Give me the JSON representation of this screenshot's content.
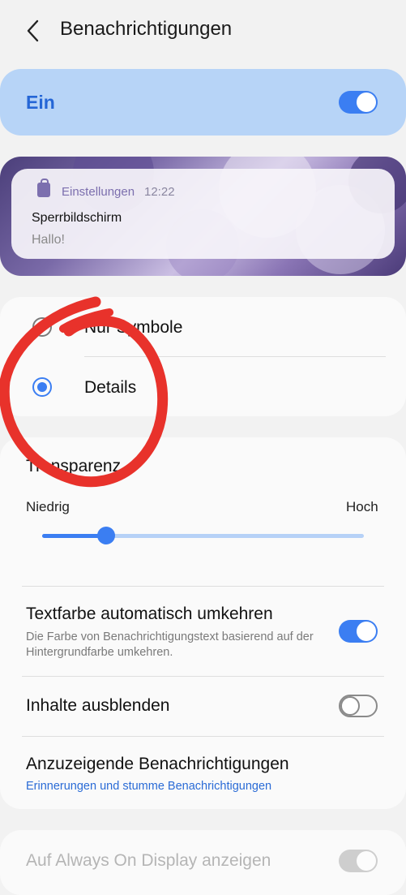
{
  "header": {
    "title": "Benachrichtigungen",
    "back_icon": "chevron-left-icon"
  },
  "master": {
    "label": "Ein",
    "enabled": true
  },
  "preview": {
    "app_name": "Einstellungen",
    "time": "12:22",
    "title": "Sperrbildschirm",
    "message": "Hallo!"
  },
  "style_options": [
    {
      "label": "Nur Symbole",
      "selected": false
    },
    {
      "label": "Details",
      "selected": true
    }
  ],
  "transparency": {
    "label": "Transparenz",
    "low_label": "Niedrig",
    "high_label": "Hoch",
    "value": 0.2
  },
  "rows": {
    "invert_text": {
      "title": "Textfarbe automatisch umkehren",
      "subtitle": "Die Farbe von Benachrichtigungstext basierend auf der Hintergrundfarbe umkehren.",
      "enabled": true
    },
    "hide_content": {
      "title": "Inhalte ausblenden",
      "enabled": false
    },
    "notifications_to_show": {
      "title": "Anzuzeigende Benachrichtigungen",
      "subtitle": "Erinnerungen und stumme Benachrichtigungen"
    },
    "aod": {
      "title": "Auf Always On Display anzeigen",
      "enabled": true,
      "disabled": true
    }
  },
  "colors": {
    "accent": "#3b7ef2",
    "master_bg": "#b7d4f7",
    "annotation": "#e8322b"
  }
}
